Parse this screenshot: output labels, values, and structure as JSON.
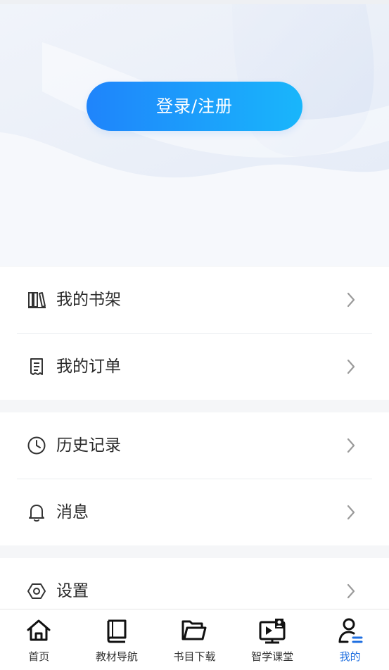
{
  "header": {
    "login_label": "登录/注册"
  },
  "menu": {
    "group1": [
      {
        "label": "我的书架",
        "icon": "bookshelf-icon"
      },
      {
        "label": "我的订单",
        "icon": "receipt-icon"
      }
    ],
    "group2": [
      {
        "label": "历史记录",
        "icon": "clock-icon"
      },
      {
        "label": "消息",
        "icon": "bell-icon"
      }
    ],
    "group3": [
      {
        "label": "设置",
        "icon": "settings-hexagon-icon"
      }
    ]
  },
  "tabbar": {
    "items": [
      {
        "label": "首页",
        "icon": "home-icon"
      },
      {
        "label": "教材导航",
        "icon": "book-icon"
      },
      {
        "label": "书目下载",
        "icon": "folder-icon"
      },
      {
        "label": "智学课堂",
        "icon": "classroom-icon"
      },
      {
        "label": "我的",
        "icon": "user-profile-icon"
      }
    ],
    "active_index": 4
  },
  "colors": {
    "accent": "#1f6fe0",
    "button_gradient_start": "#1f84fb",
    "button_gradient_end": "#19b6fb"
  }
}
